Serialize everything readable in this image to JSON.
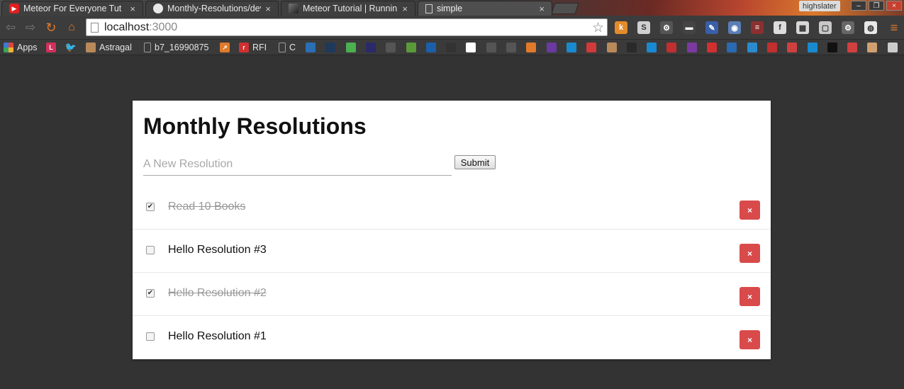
{
  "browser": {
    "tabs": [
      {
        "title": "Meteor For Everyone Tut",
        "favicon": "youtube-icon"
      },
      {
        "title": "Monthly-Resolutions/dev",
        "favicon": "github-icon"
      },
      {
        "title": "Meteor Tutorial | Runnin",
        "favicon": "meteor-icon"
      },
      {
        "title": "simple",
        "favicon": "page-icon"
      }
    ],
    "tab_close_glyph": "×",
    "profile_name": "highslater",
    "window_controls": [
      "–",
      "❐",
      "×"
    ],
    "address": {
      "host": "localhost",
      "port": ":3000"
    },
    "extensions": [
      {
        "label": "k",
        "color": "#e38b2a",
        "name": "k-extension-icon"
      },
      {
        "label": "S",
        "color": "#cfcfcf",
        "name": "s-extension-icon"
      },
      {
        "label": "⚙",
        "color": "#555555",
        "name": "settings-extension-icon"
      },
      {
        "label": "▬",
        "color": "#444444",
        "name": "printer-extension-icon"
      },
      {
        "label": "✎",
        "color": "#3a5fa8",
        "name": "pen-extension-icon"
      },
      {
        "label": "◉",
        "color": "#5b7fb5",
        "name": "camera-extension-icon"
      },
      {
        "label": "≡",
        "color": "#8a3030",
        "name": "stripe-extension-icon"
      },
      {
        "label": "f",
        "color": "#dcdcdc",
        "name": "fonts-extension-icon"
      },
      {
        "label": "▦",
        "color": "#d8d8d8",
        "name": "grid-extension-icon"
      },
      {
        "label": "▢",
        "color": "#c8c8c8",
        "name": "page-extension-icon"
      },
      {
        "label": "⚙",
        "color": "#666666",
        "name": "gear-extension-icon"
      },
      {
        "label": "◍",
        "color": "#e8e8e8",
        "name": "cat-extension-icon"
      }
    ],
    "menu_glyph": "≡",
    "bookmarks": [
      {
        "label": "Apps",
        "icon": "apps-icon",
        "color": "#e0453a"
      },
      {
        "label": "",
        "icon": "l-icon",
        "color": "#d0305a"
      },
      {
        "label": "",
        "icon": "twitter-icon",
        "color": "#3a9ad9"
      },
      {
        "label": "Astragal",
        "icon": "astragal-icon",
        "color": "#b88a5a"
      },
      {
        "label": "b7_16990875",
        "icon": "page-icon",
        "color": "#555555"
      },
      {
        "label": "",
        "icon": "chart-icon",
        "color": "#e07a2a"
      },
      {
        "label": "RFI",
        "icon": "rfi-icon",
        "color": "#d03030"
      },
      {
        "label": "C",
        "icon": "page-icon",
        "color": "#555555"
      }
    ],
    "bookmark_icons": [
      "#2a6fb5",
      "#1e3a5a",
      "#4caf50",
      "#2a2a6a",
      "#555555",
      "#5a9a3a",
      "#1c5fa8",
      "#333333",
      "#ffffff",
      "#555555",
      "#555555",
      "#e07a2a",
      "#6a3aa0",
      "#1a8ad0",
      "#d03a3a",
      "#b88a5a",
      "#2a2a2a",
      "#1a8ad0",
      "#c03030",
      "#7a3aa0",
      "#d03030",
      "#2a6ab0",
      "#2a8ad0",
      "#c03030",
      "#d04040",
      "#1a8ad0",
      "#111111",
      "#d04040",
      "#d0a070",
      "#cccccc"
    ]
  },
  "app": {
    "title": "Monthly Resolutions",
    "input_placeholder": "A New Resolution",
    "input_value": "",
    "submit_label": "Submit",
    "delete_glyph": "×",
    "resolutions": [
      {
        "text": "Read 10 Books",
        "checked": true
      },
      {
        "text": "Hello Resolution #3",
        "checked": false
      },
      {
        "text": "Hello Resolution #2",
        "checked": true
      },
      {
        "text": "Hello Resolution #1",
        "checked": false
      }
    ],
    "colors": {
      "delete": "#d94a4a",
      "done_text": "#999999",
      "page_bg": "#333333"
    }
  }
}
